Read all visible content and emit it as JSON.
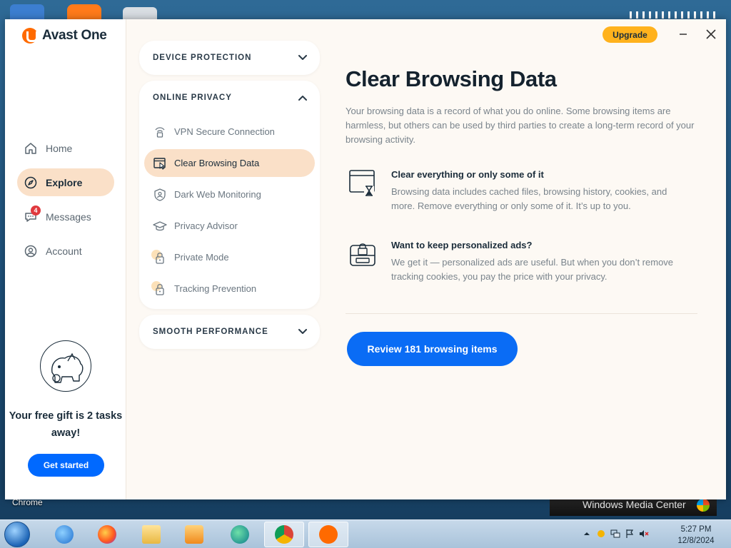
{
  "desktop": {
    "chrome_label": "Chrome",
    "wmc_label": "Windows Media Center"
  },
  "app": {
    "name": "Avast One",
    "upgrade_label": "Upgrade",
    "brand_color": "#ff6a00",
    "accent_color": "#0a6cf5",
    "highlight_color": "#fae0c8"
  },
  "sidebar": {
    "items": [
      {
        "label": "Home",
        "icon": "home-icon"
      },
      {
        "label": "Explore",
        "icon": "compass-icon",
        "active": true
      },
      {
        "label": "Messages",
        "icon": "chat-icon",
        "badge": "4"
      },
      {
        "label": "Account",
        "icon": "user-icon"
      }
    ],
    "gift_text": "Your free gift is 2 tasks away!",
    "get_started_label": "Get started"
  },
  "sections": {
    "device_protection": "DEVICE PROTECTION",
    "online_privacy": "ONLINE PRIVACY",
    "smooth_performance": "SMOOTH PERFORMANCE",
    "privacy_items": [
      {
        "label": "VPN Secure Connection",
        "icon": "vpn-icon"
      },
      {
        "label": "Clear Browsing Data",
        "icon": "browser-cursor-icon",
        "active": true
      },
      {
        "label": "Dark Web Monitoring",
        "icon": "shield-user-icon"
      },
      {
        "label": "Privacy Advisor",
        "icon": "graduation-cap-icon"
      },
      {
        "label": "Private Mode",
        "icon": "lock-icon"
      },
      {
        "label": "Tracking Prevention",
        "icon": "lock-icon"
      }
    ]
  },
  "content": {
    "title": "Clear Browsing Data",
    "description": "Your browsing data is a record of what you do online. Some browsing items are harmless, but others can be used by third parties to create a long-term record of your browsing activity.",
    "features": [
      {
        "title": "Clear everything or only some of it",
        "text": "Browsing data includes cached files, browsing history, cookies, and more. Remove everything or only some of it. It’s up to you.",
        "icon": "browser-hourglass-icon"
      },
      {
        "title": "Want to keep personalized ads?",
        "text": "We get it — personalized ads are useful. But when you don’t remove tracking cookies, you pay the price with your privacy.",
        "icon": "locked-box-icon"
      }
    ],
    "review_button": "Review 181 browsing items"
  },
  "taskbar": {
    "time": "5:27 PM",
    "date": "12/8/2024"
  }
}
